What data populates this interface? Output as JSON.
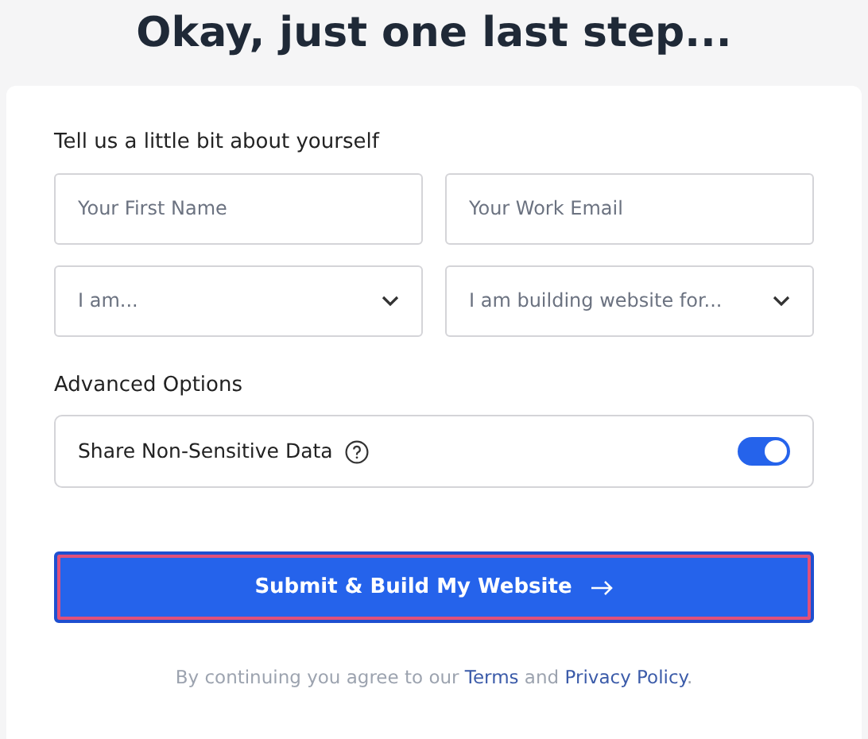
{
  "heading": "Okay, just one last step...",
  "section_label": "Tell us a little bit about yourself",
  "fields": [
    {
      "kind": "input",
      "placeholder": "Your First Name"
    },
    {
      "kind": "input",
      "placeholder": "Your Work Email"
    },
    {
      "kind": "select",
      "placeholder": "I am..."
    },
    {
      "kind": "select",
      "placeholder": "I am building website for..."
    }
  ],
  "advanced_label": "Advanced Options",
  "options": [
    {
      "label": "Share Non-Sensitive Data",
      "on": true
    }
  ],
  "submit": {
    "label": "Submit & Build My Website",
    "focused": true
  },
  "footer": {
    "before": "By continuing you agree to our",
    "terms": "Terms",
    "middle": "and",
    "privacy": "Privacy Policy",
    "after": "."
  }
}
